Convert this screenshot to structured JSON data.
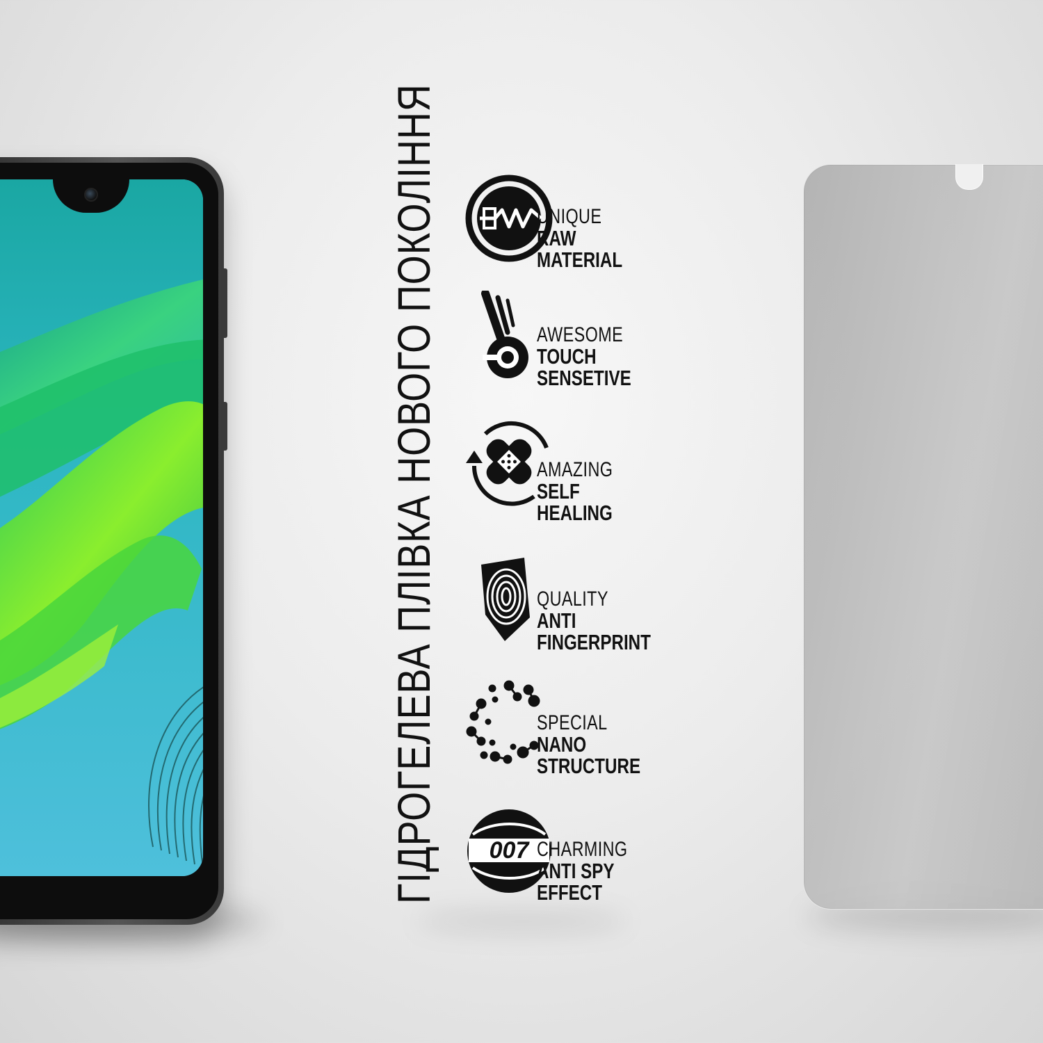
{
  "title": "ГІДРОГЕЛЕВА ПЛІВКА НОВОГО ПОКОЛІННЯ",
  "features": [
    {
      "icon": "raw-material-icon",
      "line1": "UNIQUE",
      "line2": "RAW",
      "line3": "MATERIAL"
    },
    {
      "icon": "touch-icon",
      "line1": "AWESOME",
      "line2": "TOUCH",
      "line3": "SENSETIVE"
    },
    {
      "icon": "self-healing-icon",
      "line1": "AMAZING",
      "line2": "SELF",
      "line3": "HEALING"
    },
    {
      "icon": "fingerprint-icon",
      "line1": "QUALITY",
      "line2": "ANTI",
      "line3": "FINGERPRINT"
    },
    {
      "icon": "nano-structure-icon",
      "line1": "SPECIAL",
      "line2": "NANO",
      "line3": "STRUCTURE"
    },
    {
      "icon": "anti-spy-icon",
      "line1": "CHARMING",
      "line2": "ANTI SPY",
      "line3": "EFFECT",
      "badge": "007"
    }
  ]
}
